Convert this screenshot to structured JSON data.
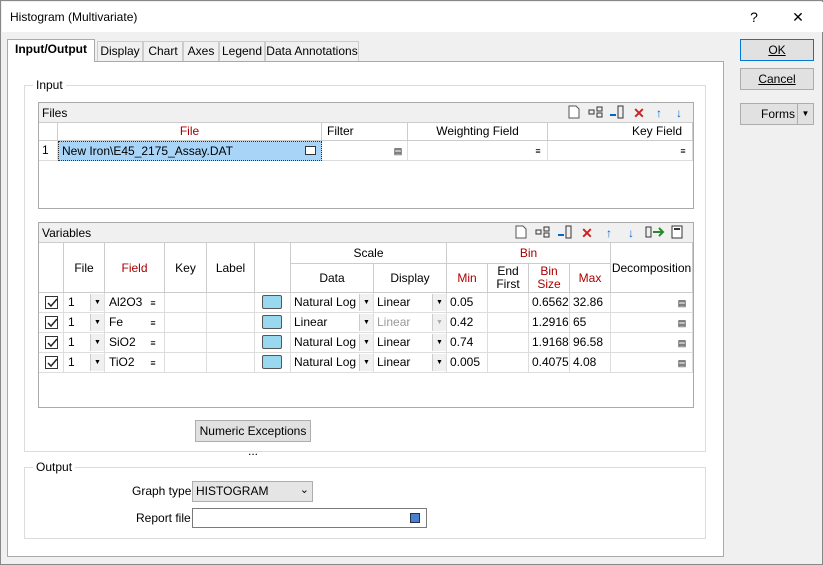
{
  "window": {
    "title": "Histogram (Multivariate)",
    "help_glyph": "?",
    "close_glyph": "✕"
  },
  "tabs": [
    "Input/Output",
    "Display",
    "Chart",
    "Axes",
    "Legend",
    "Data Annotations"
  ],
  "buttons": {
    "ok": "OK",
    "cancel": "Cancel",
    "forms": "Forms"
  },
  "input_group": {
    "label": "Input"
  },
  "files": {
    "title": "Files",
    "columns": [
      "File",
      "Filter",
      "Weighting Field",
      "Key Field"
    ],
    "rows": [
      {
        "index": "1",
        "file": "New Iron\\E45_2175_Assay.DAT"
      }
    ]
  },
  "variables": {
    "title": "Variables",
    "headers": {
      "file": "File",
      "field": "Field",
      "key": "Key",
      "label": "Label",
      "scale": "Scale",
      "data": "Data",
      "display": "Display",
      "bin": "Bin",
      "min": "Min",
      "end_first": "End First",
      "bin_size": "Bin Size",
      "max": "Max",
      "decomposition": "Decomposition"
    },
    "rows": [
      {
        "file": "1",
        "field": "Al2O3",
        "data": "Natural Log",
        "display": "Linear",
        "display_disabled": false,
        "min": "0.05",
        "bin_size": "0.6562",
        "max": "32.86"
      },
      {
        "file": "1",
        "field": "Fe",
        "data": "Linear",
        "display": "Linear",
        "display_disabled": true,
        "min": "0.42",
        "bin_size": "1.2916",
        "max": "65"
      },
      {
        "file": "1",
        "field": "SiO2",
        "data": "Natural Log",
        "display": "Linear",
        "display_disabled": false,
        "min": "0.74",
        "bin_size": "1.9168",
        "max": "96.58"
      },
      {
        "file": "1",
        "field": "TiO2",
        "data": "Natural Log",
        "display": "Linear",
        "display_disabled": false,
        "min": "0.005",
        "bin_size": "0.4075",
        "max": "4.08"
      }
    ]
  },
  "numeric_exceptions": "Numeric Exceptions ...",
  "output_group": {
    "label": "Output",
    "graph_type_label": "Graph type",
    "graph_type_value": "HISTOGRAM",
    "report_file_label": "Report file",
    "report_file_value": ""
  },
  "colors": {
    "selected_row": "#a8d4f8",
    "swatch": "#99d9f0",
    "accent_red": "#cc2222",
    "accent_blue": "#0066cc"
  }
}
